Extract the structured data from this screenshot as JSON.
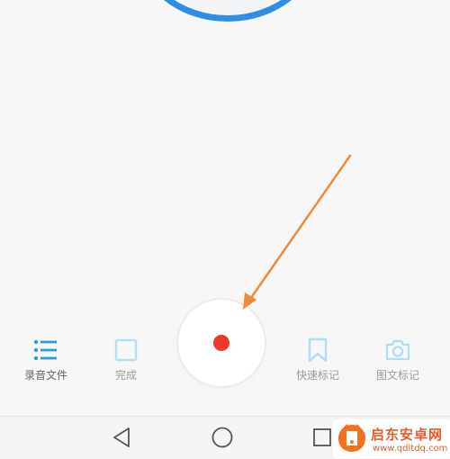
{
  "colors": {
    "accent": "#2a9fd6",
    "disabled": "#b3dcef",
    "record": "#f0382b",
    "annotation_arrow": "#f08a3a",
    "top_ring": "#2f8fe6"
  },
  "toolbar": {
    "recordings_label": "录音文件",
    "recordings_icon": "list-icon",
    "done_label": "完成",
    "done_icon": "square-icon",
    "quick_mark_label": "快速标记",
    "quick_mark_icon": "bookmark-icon",
    "image_mark_label": "图文标记",
    "image_mark_icon": "camera-icon",
    "record_icon": "record-dot-icon"
  },
  "navbar": {
    "back_icon": "triangle-back-icon",
    "home_icon": "circle-home-icon",
    "recents_icon": "square-recents-icon"
  },
  "watermark": {
    "name": "启东安卓网",
    "url": "www.qdltdq.com"
  }
}
